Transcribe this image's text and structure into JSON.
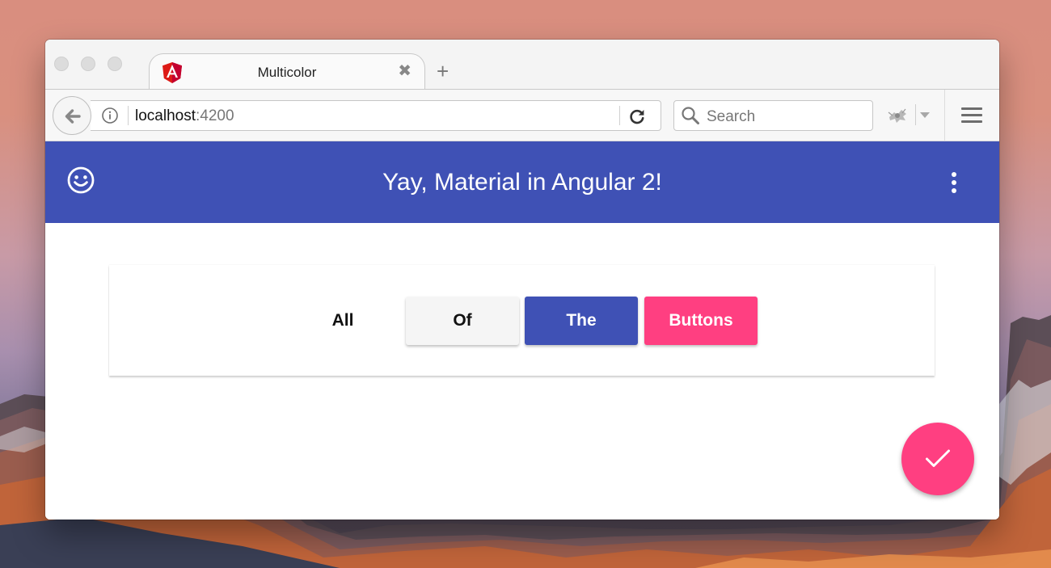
{
  "browser": {
    "tab": {
      "title": "Multicolor",
      "close_glyph": "✖",
      "icon": "angular-logo-icon"
    },
    "new_tab_glyph": "+",
    "url": {
      "host": "localhost",
      "port": ":4200"
    },
    "search": {
      "placeholder": "Search"
    },
    "icons": [
      "back-arrow-icon",
      "info-icon",
      "reload-icon",
      "search-icon",
      "extension-icon",
      "hamburger-menu-icon"
    ]
  },
  "app": {
    "toolbar": {
      "title": "Yay, Material in Angular 2!",
      "left_icon": "smiley-icon",
      "right_icon": "more-vert-icon"
    },
    "buttons": [
      {
        "label": "All",
        "style": "flat"
      },
      {
        "label": "Of",
        "style": "raised"
      },
      {
        "label": "The",
        "style": "primary"
      },
      {
        "label": "Buttons",
        "style": "accent"
      }
    ],
    "fab": {
      "icon": "check-icon"
    }
  },
  "colors": {
    "primary": "#3f51b5",
    "accent": "#ff3f81",
    "angular_red": "#dd1b16"
  }
}
